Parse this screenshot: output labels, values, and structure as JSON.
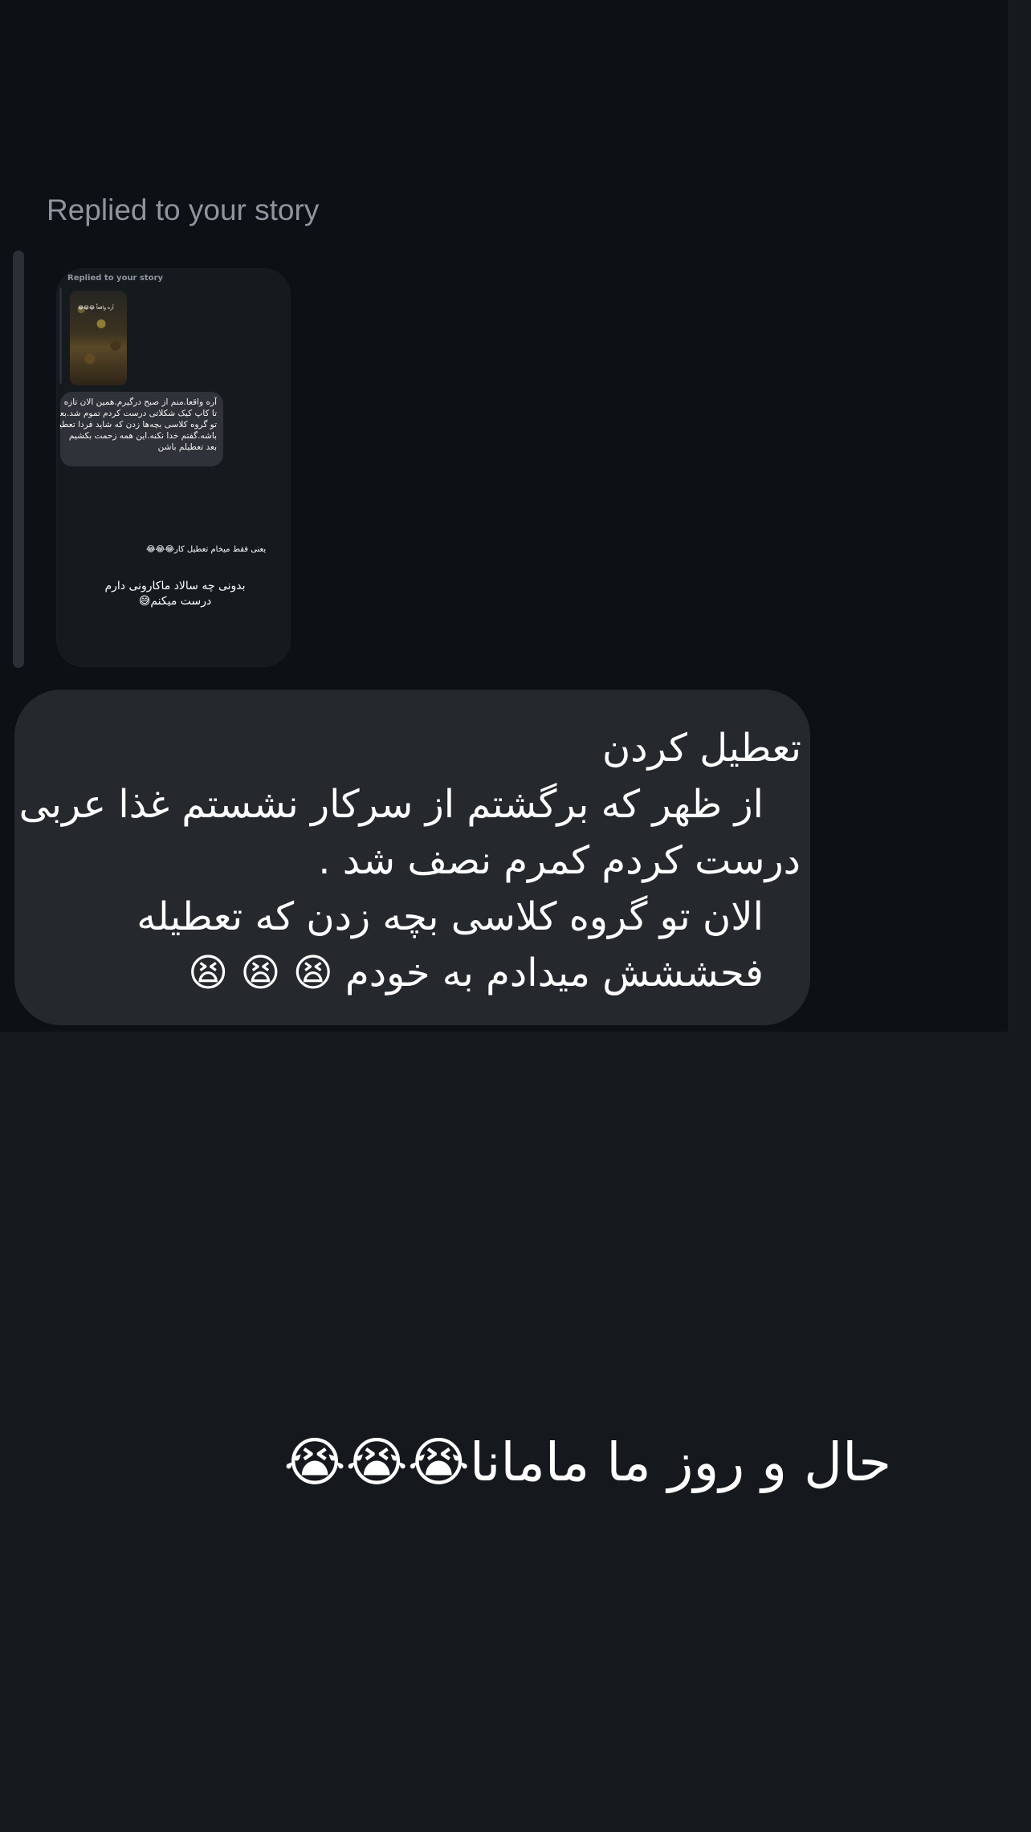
{
  "conversation": {
    "header_label": "Replied to your story",
    "story_preview": {
      "inner_header_label": "Replied to your story",
      "thumbnail_text": "آره واقعاً 😂😂😂",
      "inner_message_lines": [
        "آره واقعا.منم از صبح درگیرم.همین الان تازه ۳۰",
        "تا کاپ کیک شکلاتی درست کردم تموم شد.بعد",
        "تو گروه کلاسی بچه‌ها زدن که شاید فردا تعطیل",
        "باشه.گفتم خدا نکنه.این همه زحمت بکشیم",
        "بعد تعطیلم باشن"
      ],
      "caption_top": "یعنی فقط میخام تعطیل کار😂😂😂",
      "caption_main_lines": [
        "بدونی چه سالاد ماکارونی دارم",
        "درست میکنم😅"
      ]
    },
    "main_message_lines": [
      "تعطیل کردن",
      "از ظهر که برگشتم از سرکار نشستم غذا عربی",
      "درست کردم کمرم نصف شد .",
      "الان تو گروه کلاسی بچه زدن که تعطیله",
      "فحششش میدادم به خودم 😫 😫 😫"
    ]
  },
  "overlay_caption": "حال و روز ما مامانا😭😭😭"
}
